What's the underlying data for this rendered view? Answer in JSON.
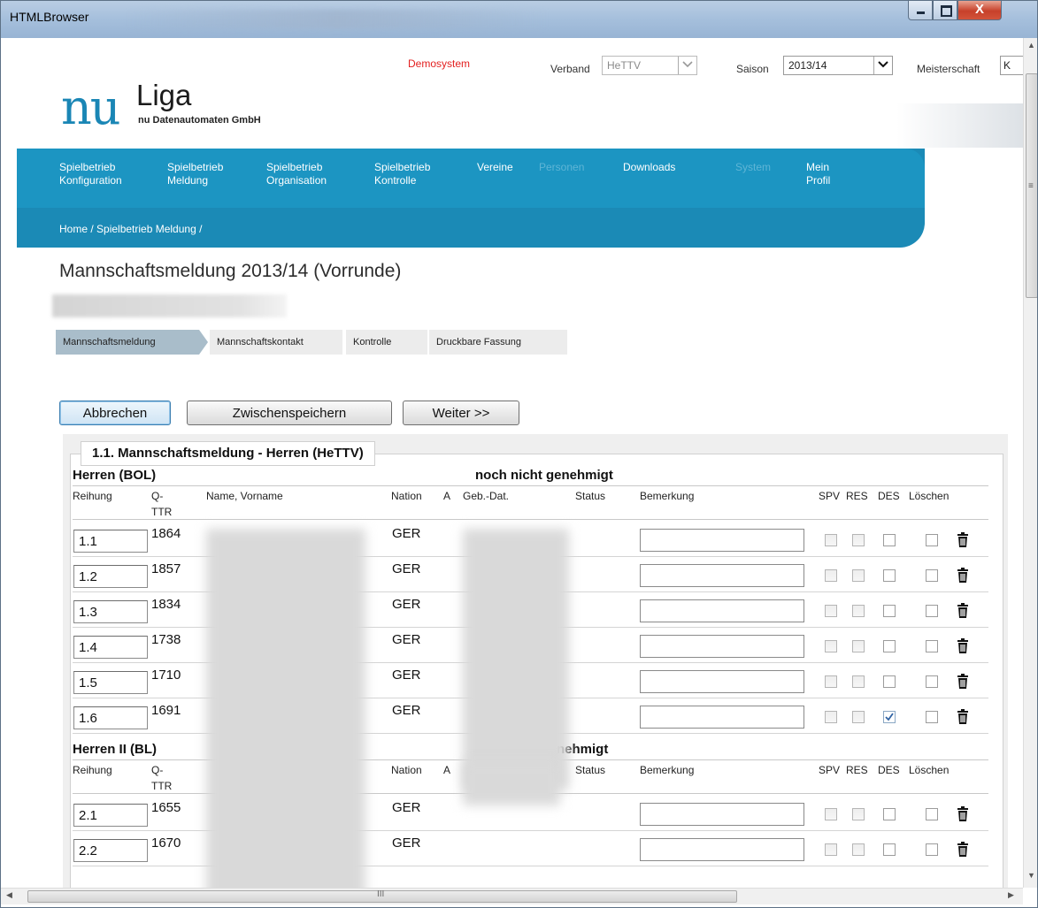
{
  "window": {
    "title": "HTMLBrowser",
    "close_glyph": "X"
  },
  "header": {
    "logo_nu": "nu",
    "logo_liga": "Liga",
    "company": "nu Datenautomaten GmbH",
    "demo": "Demosystem",
    "verband_label": "Verband",
    "verband_value": "HeTTV",
    "saison_label": "Saison",
    "saison_value": "2013/14",
    "meisterschaft_label": "Meisterschaft",
    "meisterschaft_value": "K"
  },
  "nav": {
    "items": [
      {
        "line1": "Spielbetrieb",
        "line2": "Konfiguration",
        "state": "normal"
      },
      {
        "line1": "Spielbetrieb",
        "line2": "Meldung",
        "state": "active"
      },
      {
        "line1": "Spielbetrieb",
        "line2": "Organisation",
        "state": "normal"
      },
      {
        "line1": "Spielbetrieb",
        "line2": "Kontrolle",
        "state": "normal"
      },
      {
        "line1": "Vereine",
        "line2": "",
        "state": "normal"
      },
      {
        "line1": "Personen",
        "line2": "",
        "state": "disabled"
      },
      {
        "line1": "Downloads",
        "line2": "",
        "state": "normal"
      },
      {
        "line1": "System",
        "line2": "",
        "state": "disabled"
      },
      {
        "line1": "Mein",
        "line2": "Profil",
        "state": "normal"
      }
    ],
    "breadcrumb": "Home / Spielbetrieb Meldung /"
  },
  "page": {
    "title": "Mannschaftsmeldung 2013/14 (Vorrunde)",
    "steps": [
      "Mannschaftsmeldung",
      "Mannschaftskontakt",
      "Kontrolle",
      "Druckbare Fassung"
    ],
    "buttons": {
      "cancel": "Abbrechen",
      "save": "Zwischenspeichern",
      "next": "Weiter >>"
    },
    "legend": "1.1. Mannschaftsmeldung - Herren (HeTTV)"
  },
  "columns": {
    "reihung": "Reihung",
    "qttr_1": "Q-",
    "qttr_2": "TTR",
    "name": "Name, Vorname",
    "nation": "Nation",
    "a": "A",
    "gebdat": "Geb.-Dat.",
    "status": "Status",
    "bemerkung": "Bemerkung",
    "spv": "SPV",
    "res": "RES",
    "des": "DES",
    "loeschen": "Löschen"
  },
  "teams": [
    {
      "name": "Herren (BOL)",
      "status": "noch nicht genehmigt",
      "rows": [
        {
          "reihung": "1.1",
          "qttr": "1864",
          "nation": "GER",
          "des_checked": false
        },
        {
          "reihung": "1.2",
          "qttr": "1857",
          "nation": "GER",
          "des_checked": false
        },
        {
          "reihung": "1.3",
          "qttr": "1834",
          "nation": "GER",
          "des_checked": false
        },
        {
          "reihung": "1.4",
          "qttr": "1738",
          "nation": "GER",
          "des_checked": false
        },
        {
          "reihung": "1.5",
          "qttr": "1710",
          "nation": "GER",
          "des_checked": false
        },
        {
          "reihung": "1.6",
          "qttr": "1691",
          "nation": "GER",
          "des_checked": true
        }
      ]
    },
    {
      "name": "Herren II (BL)",
      "status": "nehmigt",
      "rows": [
        {
          "reihung": "2.1",
          "qttr": "1655",
          "nation": "GER",
          "des_checked": false
        },
        {
          "reihung": "2.2",
          "qttr": "1670",
          "nation": "GER",
          "des_checked": false
        }
      ]
    }
  ],
  "colors": {
    "nav_blue": "#1c95c2",
    "nav_blue_dark": "#1b8ab6",
    "logo_blue": "#1a86b5",
    "demo_red": "#e32020"
  },
  "icons": {
    "trash": "trash-icon",
    "dropdown": "chevron-down-icon"
  }
}
